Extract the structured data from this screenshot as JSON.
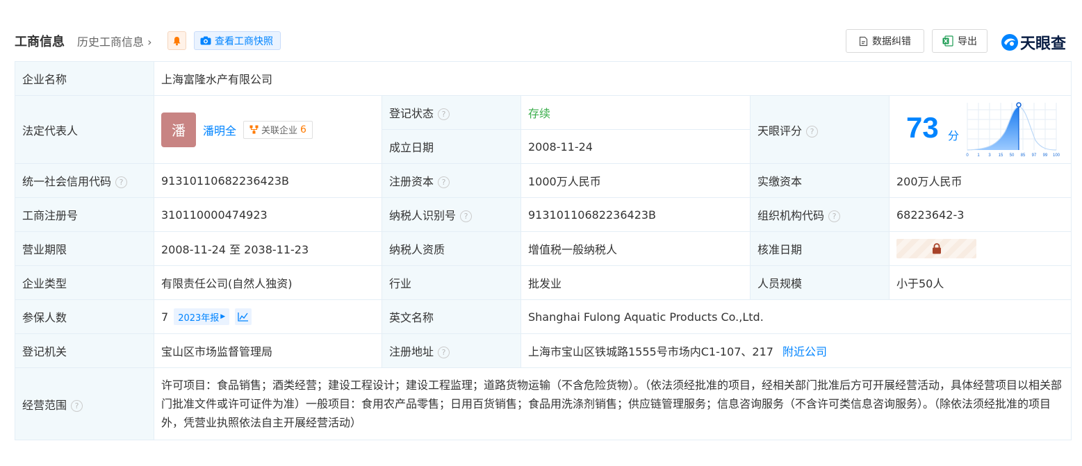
{
  "header": {
    "title": "工商信息",
    "history": "历史工商信息",
    "snapshot": "查看工商快照",
    "correction": "数据纠错",
    "export": "导出",
    "logo_text": "天眼查"
  },
  "rows": {
    "company_name": {
      "label": "企业名称",
      "value": "上海富隆水产有限公司"
    },
    "legal_rep": {
      "label": "法定代表人",
      "avatar": "潘",
      "name": "潘明全",
      "related_label": "关联企业",
      "related_count": "6"
    },
    "reg_status": {
      "label": "登记状态",
      "value": "存续"
    },
    "founded": {
      "label": "成立日期",
      "value": "2008-11-24"
    },
    "score": {
      "label": "天眼评分",
      "value": "73",
      "unit": "分",
      "axis_ticks": [
        "0",
        "1",
        "3",
        "15",
        "50",
        "85",
        "97",
        "99",
        "100"
      ]
    },
    "credit_code": {
      "label": "统一社会信用代码",
      "value": "91310110682236423B"
    },
    "reg_capital": {
      "label": "注册资本",
      "value": "1000万人民币"
    },
    "paid_capital": {
      "label": "实缴资本",
      "value": "200万人民币"
    },
    "reg_no": {
      "label": "工商注册号",
      "value": "310110000474923"
    },
    "taxpayer_id": {
      "label": "纳税人识别号",
      "value": "91310110682236423B"
    },
    "org_code": {
      "label": "组织机构代码",
      "value": "68223642-3"
    },
    "term": {
      "label": "营业期限",
      "value": "2008-11-24 至 2038-11-23"
    },
    "taxpayer_type": {
      "label": "纳税人资质",
      "value": "增值税一般纳税人"
    },
    "approve_date": {
      "label": "核准日期"
    },
    "company_type": {
      "label": "企业类型",
      "value": "有限责任公司(自然人独资)"
    },
    "industry": {
      "label": "行业",
      "value": "批发业"
    },
    "staff_size": {
      "label": "人员规模",
      "value": "小于50人"
    },
    "insured": {
      "label": "参保人数",
      "value": "7",
      "year_tag": "2023年报"
    },
    "english_name": {
      "label": "英文名称",
      "value": "Shanghai Fulong Aquatic Products Co.,Ltd."
    },
    "authority": {
      "label": "登记机关",
      "value": "宝山区市场监督管理局"
    },
    "address": {
      "label": "注册地址",
      "value": "上海市宝山区铁城路1555号市场内C1-107、217",
      "nearby": "附近公司"
    },
    "scope": {
      "label": "经营范围",
      "value": "许可项目：食品销售；酒类经营；建设工程设计；建设工程监理；道路货物运输（不含危险货物）。（依法须经批准的项目，经相关部门批准后方可开展经营活动，具体经营项目以相关部门批准文件或许可证件为准）一般项目：食用农产品零售；日用百货销售；食品用洗涤剂销售；供应链管理服务；信息咨询服务（不含许可类信息咨询服务）。（除依法须经批准的项目外，凭营业执照依法自主开展经营活动）"
    }
  },
  "colors": {
    "accent": "#0084ff",
    "status_green": "#3aae4b",
    "label_bg": "#f2f9fc"
  }
}
